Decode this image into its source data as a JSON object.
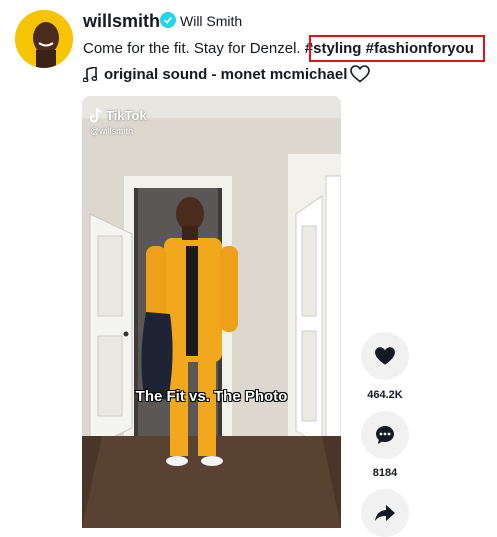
{
  "author": {
    "username": "willsmith",
    "nickname": "Will Smith",
    "verified": true
  },
  "caption": {
    "text": "Come for the fit. Stay for Denzel.",
    "hashtags": [
      "#styling",
      "#fashionforyou"
    ]
  },
  "music": {
    "label": "original sound - monet mcmichael"
  },
  "video": {
    "watermark": "TikTok",
    "watermark_handle": "@willsmith",
    "overlay_text": "The Fit vs. The Photo"
  },
  "actions": {
    "like_count": "464.2K",
    "comment_count": "8184"
  },
  "colors": {
    "highlight_border": "#e0121a",
    "verified": "#20d5ec",
    "action_bg": "#f1f1f2",
    "tracksuit": "#f2a81d"
  },
  "icons": [
    "avatar",
    "verified-badge-icon",
    "music-note-icon",
    "heart-outline-icon",
    "tiktok-logo-icon",
    "heart-icon",
    "comment-icon",
    "share-icon"
  ]
}
